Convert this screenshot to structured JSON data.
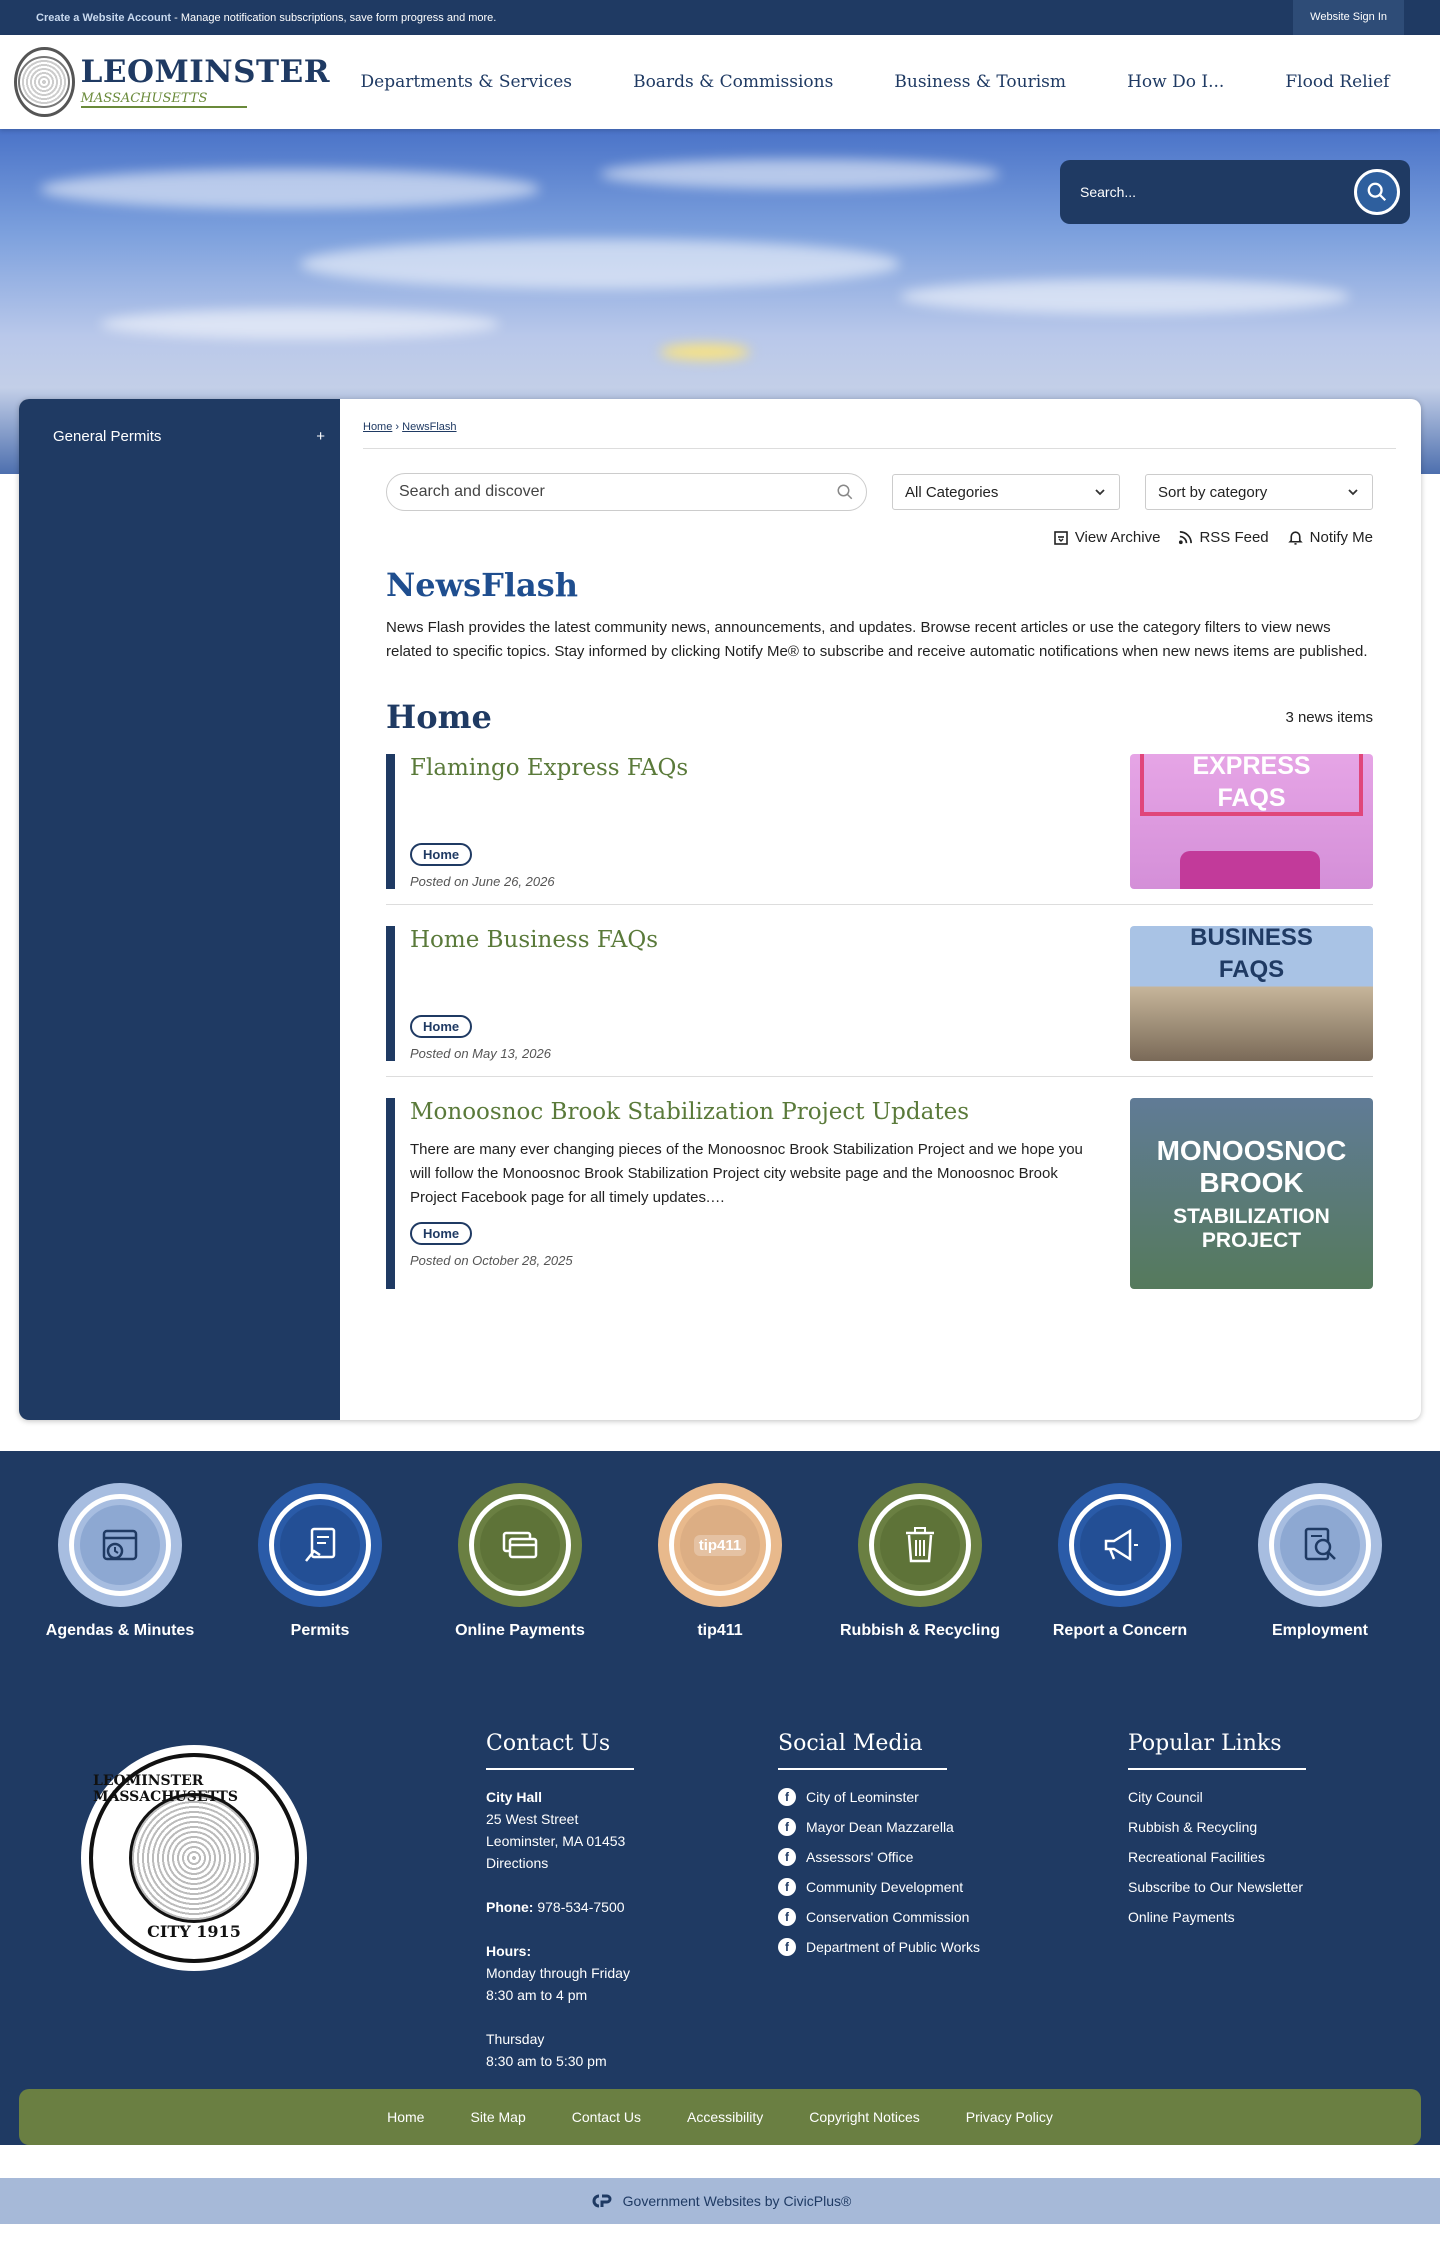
{
  "topbar": {
    "create_account": "Create a Website Account",
    "create_desc": " - Manage notification subscriptions, save form progress and more.",
    "sign_in": "Website Sign In"
  },
  "logo": {
    "city": "LEOMINSTER",
    "state": "MASSACHUSETTS"
  },
  "nav": [
    "Departments & Services",
    "Boards & Commissions",
    "Business & Tourism",
    "How Do I...",
    "Flood Relief"
  ],
  "hero": {
    "search_placeholder": "Search..."
  },
  "sidebar": {
    "items": [
      {
        "label": "General Permits",
        "toggle": "+"
      }
    ]
  },
  "breadcrumb": {
    "home": "Home",
    "sep": "›",
    "current": "NewsFlash"
  },
  "controls": {
    "search_placeholder": "Search and discover",
    "category": "All Categories",
    "sort": "Sort by category"
  },
  "actions": {
    "archive": "View Archive",
    "rss": "RSS Feed",
    "notify": "Notify Me"
  },
  "page": {
    "title": "NewsFlash",
    "description": "News Flash provides the latest community news, announcements, and updates. Browse recent articles or use the category filters to view news related to specific topics. Stay informed by clicking Notify Me® to subscribe and receive automatic notifications when new news items are published.",
    "section": "Home",
    "count": "3 news items"
  },
  "news": [
    {
      "title": "Flamingo Express FAQs",
      "excerpt": "",
      "tag": "Home",
      "posted": "Posted on June 26, 2026",
      "thumb_line1": "EXPRESS",
      "thumb_line2": "FAQS"
    },
    {
      "title": "Home Business FAQs",
      "excerpt": "",
      "tag": "Home",
      "posted": "Posted on May 13, 2026",
      "thumb_line1": "BUSINESS",
      "thumb_line2": "FAQS"
    },
    {
      "title": "Monoosnoc Brook Stabilization Project Updates",
      "excerpt": "There are many ever changing pieces of the Monoosnoc Brook Stabilization Project and we hope you will follow the Monoosnoc Brook Stabilization Project city website page and the Monoosnoc Brook Project Facebook page for all timely updates.…",
      "tag": "Home",
      "posted": "Posted on October 28, 2025",
      "thumb_line1": "MONOOSNOC",
      "thumb_line2": "BROOK",
      "thumb_line3": "STABILIZATION",
      "thumb_line4": "PROJECT"
    }
  ],
  "quick_links": [
    {
      "label": "Agendas & Minutes",
      "icon": "calendar-clock-icon",
      "color": "#a7bde0",
      "core": "#8da8d2"
    },
    {
      "label": "Permits",
      "icon": "permit-document-icon",
      "color": "#2a5ba8",
      "core": "#234f95"
    },
    {
      "label": "Online Payments",
      "icon": "credit-card-icon",
      "color": "#6a7f42",
      "core": "#5e7338"
    },
    {
      "label": "tip411",
      "icon": "tip411-icon",
      "color": "#e8b98c",
      "core": "#dcae84"
    },
    {
      "label": "Rubbish & Recycling",
      "icon": "trash-can-icon",
      "color": "#6a7f42",
      "core": "#5e7338"
    },
    {
      "label": "Report a Concern",
      "icon": "megaphone-icon",
      "color": "#2a5ba8",
      "core": "#234f95"
    },
    {
      "label": "Employment",
      "icon": "search-document-icon",
      "color": "#a7bde0",
      "core": "#8da8d2"
    }
  ],
  "footer": {
    "seal_top": "LEOMINSTER MASSACHUSETTS",
    "seal_bottom": "CITY 1915",
    "contact": {
      "heading": "Contact Us",
      "name": "City Hall",
      "street": "25 West Street",
      "city": "Leominster, MA 01453",
      "directions": "Directions",
      "phone_label": "Phone:",
      "phone": " 978-534-7500",
      "hours_label": "Hours:",
      "hours1": "Monday through Friday",
      "hours1_time": "8:30 am to 4 pm",
      "hours2": "Thursday",
      "hours2_time": "8:30 am to 5:30 pm"
    },
    "social": {
      "heading": "Social Media",
      "items": [
        "City of Leominster",
        "Mayor Dean Mazzarella",
        "Assessors' Office",
        "Community Development",
        "Conservation Commission",
        "Department of Public Works"
      ]
    },
    "popular": {
      "heading": "Popular Links",
      "items": [
        "City Council",
        "Rubbish & Recycling",
        "Recreational Facilities",
        "Subscribe to Our Newsletter",
        "Online Payments"
      ]
    },
    "bottom_nav": [
      "Home",
      "Site Map",
      "Contact Us",
      "Accessibility",
      "Copyright Notices",
      "Privacy Policy"
    ],
    "credit": "Government Websites by CivicPlus®"
  },
  "colors": {
    "navy": "#1f3a63",
    "green": "#6a7f42",
    "title_green": "#5a7a3a"
  }
}
